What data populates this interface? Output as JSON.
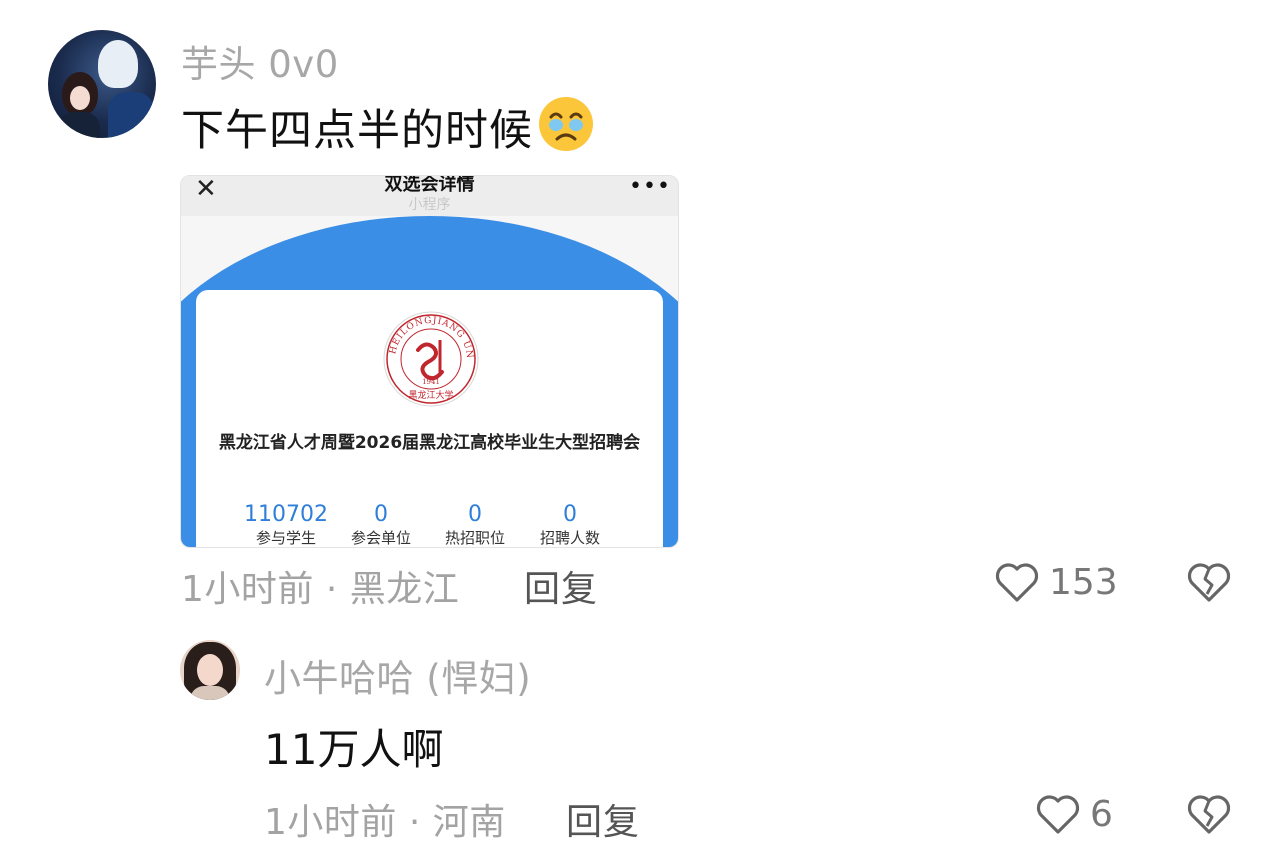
{
  "comment1": {
    "username": "芋头 0v0",
    "text": "下午四点半的时候",
    "emoji_icon": "holding-back-tears-emoji",
    "time_location": "1小时前 · 黑龙江",
    "reply_label": "回复",
    "like_count": "153"
  },
  "embedded_screenshot": {
    "nav_title": "双选会详情",
    "nav_subtitle": "小程序",
    "seal_text": "HEILONGJIANG UNIVERSITY",
    "seal_year": "1941",
    "fair_title": "黑龙江省人才周暨2026届黑龙江高校毕业生大型招聘会",
    "stats": [
      {
        "value": "110702",
        "label": "参与学生"
      },
      {
        "value": "0",
        "label": "参会单位"
      },
      {
        "value": "0",
        "label": "热招职位"
      },
      {
        "value": "0",
        "label": "招聘人数"
      }
    ],
    "colors": {
      "header_blue": "#3b8ee6",
      "stat_blue": "#2f7fd8",
      "seal_red": "#c0262d"
    }
  },
  "comment2": {
    "username": "小牛哈哈 (悍妇)",
    "text": "11万人啊",
    "time_location": "1小时前 · 河南",
    "reply_label": "回复",
    "like_count": "6"
  }
}
